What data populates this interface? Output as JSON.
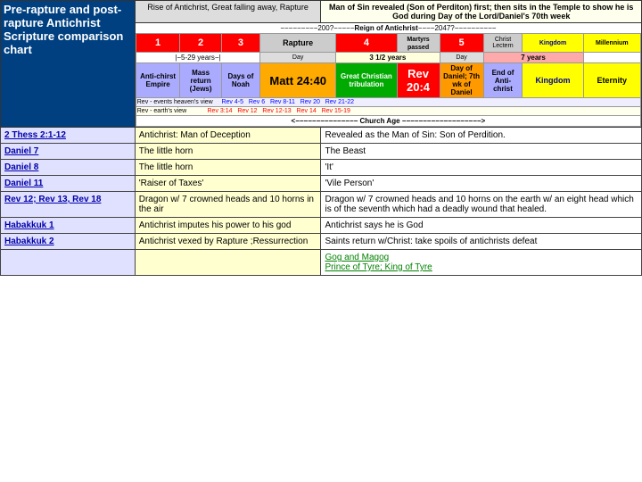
{
  "page": {
    "title": "Pre-rapture and post-rapture Antichrist Scripture comparison chart",
    "header": {
      "left_col1": "Rise of Antichrist, Great falling away, Rapture",
      "right_col1": "Man of Sin revealed (Son of Perditon) first; then sits in the Temple to show he is God during Day of the Lord/Daniel's 70th week"
    },
    "chart": {
      "numbers": [
        "1",
        "2",
        "3",
        "Rapture",
        "4",
        "",
        "5",
        "",
        "",
        ""
      ],
      "years_label": "|−5-29 years−|",
      "day_label": "Day",
      "three_half": "3 1/2 years",
      "seven_years": "7 years",
      "reign_label": "−−−−−−−−−−−−Reign of Antichrist−−−−−−2047?−−−−−−−−−−−−−−",
      "cells": {
        "antichrist_empire": "Anti-christ Empire",
        "mass_return": "Mass return (Jews)",
        "days_noah": "Days of Noah",
        "matt": "Matt 24:40",
        "great_christian": "Great Christian tribulation",
        "rev_204": "Rev 20:4",
        "day_daniel": "Day of Daniel; 7th wk of Daniel",
        "end_antichrist": "End of Anti-christ",
        "eternity": "Eternity",
        "kingdom": "Kingdom",
        "millennium": "Millennium"
      },
      "rev_rows": {
        "heaven": "Rev - events heaven's view",
        "earth": "Rev - earth's view",
        "refs_heaven": [
          "Rev 4-5",
          "Rev 6",
          "Rev 8-11",
          "Rev 20",
          "Rev 21-22"
        ],
        "refs_earth": [
          "Rev 3:14",
          "Rev 12",
          "Rev 12-13",
          "Rev 14",
          "Rev 15-19"
        ]
      },
      "church_age": "<−−−−−−−−−−−−−−− Church Age −−−−−−−−−−−−−−−−−−−>"
    },
    "rows": [
      {
        "scripture": "2 Thess 2:1-12",
        "col2": "Antichrist: Man of Deception",
        "col3": "Revealed as the Man of Sin: Son of Perdition."
      },
      {
        "scripture": "Daniel 7",
        "col2": "The little horn",
        "col3": "The Beast"
      },
      {
        "scripture": "Daniel 8",
        "col2": "The little horn",
        "col3": "'It'"
      },
      {
        "scripture": "Daniel 11",
        "col2": "'Raiser of Taxes'",
        "col3": "'Vile Person'"
      },
      {
        "scripture": "Rev 12; Rev 13, Rev 18",
        "col2": "Dragon w/ 7 crowned heads and 10 horns in the air",
        "col3": "Dragon w/ 7 crowned heads and 10 horns on the earth w/ an eight head which is of the seventh which had a deadly wound that healed."
      },
      {
        "scripture": "Habakkuk 1",
        "col2": "Antichrist imputes his power to his god",
        "col3": "Antichrist says he is God"
      },
      {
        "scripture": "Habakkuk 2",
        "col2": "Antichrist vexed by Rapture ;Ressurrection",
        "col3": "Saints return w/Christ: take spoils of antichrists defeat"
      },
      {
        "scripture": "",
        "col2": "",
        "col3_green": "Gog and Magog",
        "col3_green2": "Prince of Tyre; King of Tyre"
      }
    ]
  }
}
